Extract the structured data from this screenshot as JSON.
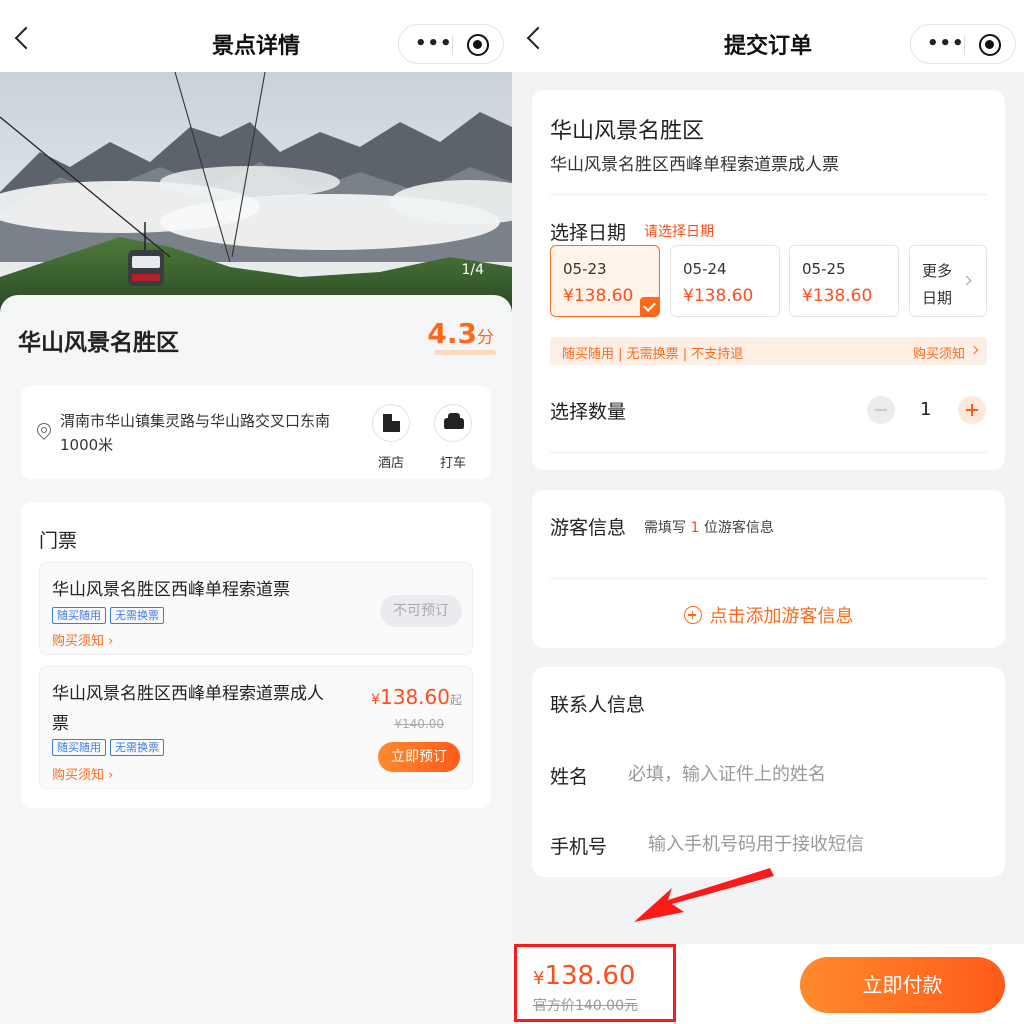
{
  "left": {
    "nav": {
      "title": "景点详情"
    },
    "hero": {
      "pager": "1/4"
    },
    "summary": {
      "name": "华山风景名胜区",
      "score": "4.3",
      "score_unit": "分"
    },
    "address": {
      "text": "渭南市华山镇集灵路与华山路交叉口东南1000米",
      "hotel": "酒店",
      "taxi": "打车"
    },
    "tickets": {
      "heading": "门票",
      "items": [
        {
          "name": "华山风景名胜区西峰单程索道票",
          "tags": [
            "随买随用",
            "无需换票"
          ],
          "notice": "购买须知",
          "status": "不可预订"
        },
        {
          "name": "华山风景名胜区西峰单程索道票成人票",
          "tags": [
            "随买随用",
            "无需换票"
          ],
          "notice": "购买须知",
          "currency": "¥",
          "price": "138.60",
          "price_suffix": "起",
          "original": "¥140.00",
          "button": "立即预订"
        }
      ]
    }
  },
  "right": {
    "nav": {
      "title": "提交订单"
    },
    "product": {
      "name": "华山风景名胜区",
      "full_name": "华山风景名胜区西峰单程索道票成人票"
    },
    "date": {
      "label": "选择日期",
      "hint": "请选择日期",
      "options": [
        {
          "date": "05-23",
          "price": "¥138.60",
          "selected": true
        },
        {
          "date": "05-24",
          "price": "¥138.60"
        },
        {
          "date": "05-25",
          "price": "¥138.60"
        }
      ],
      "more": "更多日期"
    },
    "policy": {
      "text": "随买随用 | 无需换票 | 不支持退",
      "link": "购买须知"
    },
    "quantity": {
      "label": "选择数量",
      "value": "1"
    },
    "guest": {
      "label": "游客信息",
      "hint_prefix": "需填写",
      "count": "1",
      "hint_suffix": "位游客信息",
      "add": "点击添加游客信息"
    },
    "contact": {
      "label": "联系人信息",
      "name_label": "姓名",
      "name_placeholder": "必填，输入证件上的姓名",
      "phone_label": "手机号",
      "phone_placeholder": "输入手机号码用于接收短信"
    },
    "bottom": {
      "currency": "¥",
      "price": "138.60",
      "official": "官方价140.00元",
      "pay": "立即付款"
    }
  },
  "colors": {
    "accent": "#ff6a1a",
    "price": "#ff4e1c",
    "highlight_box": "#ff1a1a",
    "tag_blue": "#3b7be6"
  }
}
